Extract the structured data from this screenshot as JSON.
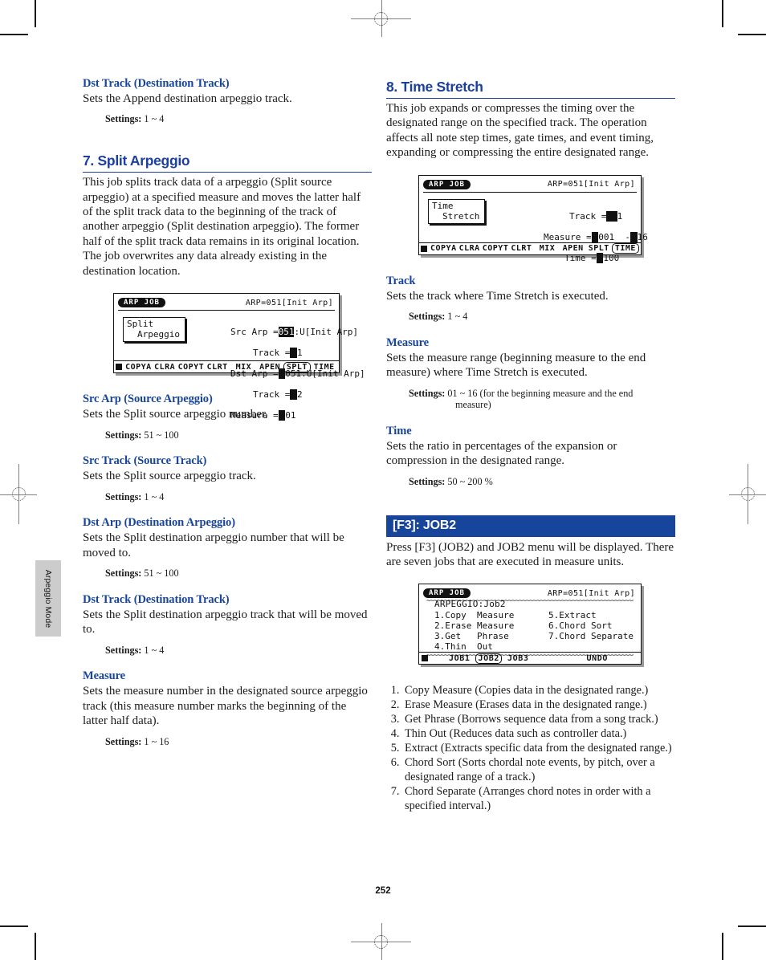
{
  "page": {
    "number": "252",
    "side_tab": "Arpeggio Mode"
  },
  "left_column": {
    "append_dst_track": {
      "heading": "Dst Track (Destination Track)",
      "body": "Sets the Append destination arpeggio track.",
      "settings_label": "Settings:",
      "settings_value": "1 ~ 4"
    },
    "split_arpeggio": {
      "heading": "7. Split Arpeggio",
      "body1": "This job splits track data of a arpeggio (Split source arpeggio) at a specified measure and moves the latter half of the split track data to the beginning of the track of another arpeggio (Split destination arpeggio). The former half of the split track data remains in its original location.",
      "body2": "The job overwrites any data already existing in the destination location."
    },
    "lcd_split": {
      "tag": "ARP JOB",
      "title": "ARP=051[Init Arp]",
      "job_line1": "Split",
      "job_line2": "Arpeggio",
      "field_src_arp_label": "Src Arp",
      "field_src_arp_value": "051",
      "field_src_arp_suffix": ":U[Init Arp]",
      "field_src_track_label": "Track",
      "field_src_track_value": "1",
      "field_dst_arp_label": "Dst Arp",
      "field_dst_arp_value": "051",
      "field_dst_arp_suffix": ":U[Init Arp]",
      "field_dst_track_label": "Track",
      "field_dst_track_value": "2",
      "field_measure_label": "Measure",
      "field_measure_value": "01",
      "fkeys": [
        "COPYA",
        "CLRA",
        "COPYT",
        "CLRT",
        "MIX",
        "APEN",
        "SPLT",
        "TIME"
      ],
      "fkey_selected": "SPLT"
    },
    "src_arp": {
      "heading": "Src Arp (Source Arpeggio)",
      "body": "Sets the Split source arpeggio number.",
      "settings_label": "Settings:",
      "settings_value": "51 ~ 100"
    },
    "src_track": {
      "heading": "Src Track (Source Track)",
      "body": "Sets the Split source arpeggio track.",
      "settings_label": "Settings:",
      "settings_value": "1 ~ 4"
    },
    "dst_arp": {
      "heading": "Dst Arp (Destination Arpeggio)",
      "body": "Sets the Split destination arpeggio number that will be moved to.",
      "settings_label": "Settings:",
      "settings_value": "51 ~ 100"
    },
    "dst_track": {
      "heading": "Dst Track (Destination Track)",
      "body": "Sets the Split destination arpeggio track that will be moved to.",
      "settings_label": "Settings:",
      "settings_value": "1 ~ 4"
    },
    "measure": {
      "heading": "Measure",
      "body": "Sets the measure number in the designated source arpeggio track (this measure number marks the beginning of the latter half data).",
      "settings_label": "Settings:",
      "settings_value": "1 ~ 16"
    }
  },
  "right_column": {
    "time_stretch": {
      "heading": "8. Time Stretch",
      "body": "This job expands or compresses the timing over the designated range on the specified track. The operation affects all note step times, gate times, and event timing, expanding or compressing the entire designated range."
    },
    "lcd_time_stretch": {
      "tag": "ARP JOB",
      "title": "ARP=051[Init Arp]",
      "job_line1": "Time",
      "job_line2": "Stretch",
      "field_track_label": "Track",
      "field_track_value": "1",
      "field_measure_label": "Measure",
      "field_measure_value": "001",
      "field_measure_end": "16",
      "field_time_label": "Time",
      "field_time_value": "100",
      "fkeys": [
        "COPYA",
        "CLRA",
        "COPYT",
        "CLRT",
        "MIX",
        "APEN",
        "SPLT",
        "TIME"
      ],
      "fkey_selected": "TIME"
    },
    "track": {
      "heading": "Track",
      "body": "Sets the track where Time Stretch is executed.",
      "settings_label": "Settings:",
      "settings_value": "1 ~ 4"
    },
    "measure": {
      "heading": "Measure",
      "body": "Sets the measure range (beginning measure to the end measure) where Time Stretch is executed.",
      "settings_label": "Settings:",
      "settings_value": "01 ~ 16 (for the beginning measure and the end",
      "settings_value2": "measure)"
    },
    "time": {
      "heading": "Time",
      "body": "Sets the ratio in percentages of the expansion or compression in the designated range.",
      "settings_label": "Settings:",
      "settings_value": "50 ~ 200 %"
    },
    "job2": {
      "banner": "[F3]: JOB2",
      "body": "Press [F3] (JOB2) and JOB2 menu will be displayed. There are seven jobs that are executed in measure units."
    },
    "lcd_job2": {
      "tag": "ARP JOB",
      "title": "ARP=051[Init Arp]",
      "menu_header": "ARPEGGIO:Job2",
      "items_left": [
        "1.Copy  Measure",
        "2.Erase Measure",
        "3.Get   Phrase",
        "4.Thin  Out"
      ],
      "items_right": [
        "5.Extract",
        "6.Chord Sort",
        "7.Chord Separate"
      ],
      "selected_item": "1.Copy  Measure",
      "fkeys": [
        "JOB1",
        "JOB2",
        "JOB3"
      ],
      "fkey_selected": "JOB2",
      "undo_label": "UNDO"
    },
    "job_list": [
      "Copy Measure (Copies data in the designated range.)",
      "Erase Measure (Erases data in the designated range.)",
      "Get Phrase (Borrows sequence data from a song track.)",
      "Thin Out (Reduces data such as controller data.)",
      "Extract (Extracts specific data from the designated range.)",
      "Chord Sort (Sorts chordal note events, by pitch, over a designated range of a track.)",
      "Chord Separate (Arranges chord notes in order with a specified interval.)"
    ]
  }
}
